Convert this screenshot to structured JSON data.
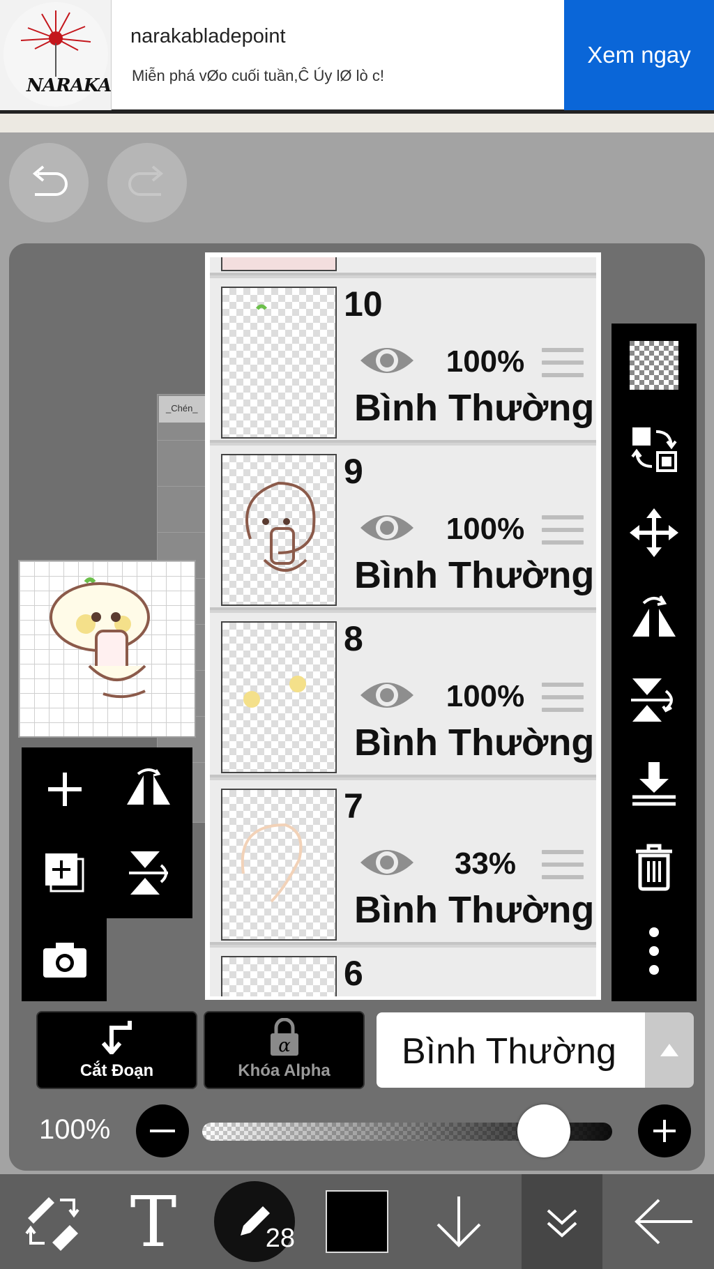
{
  "ad": {
    "title": "narakabladepoint",
    "description": "Miễn phá vØo cuối tuần,Ĉ Úy lØ lò c!",
    "cta": "Xem ngay",
    "logo_text": "NARAKA"
  },
  "canvas": {
    "label": "_Chén_"
  },
  "layers": [
    {
      "number": "10",
      "opacity": "100%",
      "mode": "Bình Thường"
    },
    {
      "number": "9",
      "opacity": "100%",
      "mode": "Bình Thường"
    },
    {
      "number": "8",
      "opacity": "100%",
      "mode": "Bình Thường"
    },
    {
      "number": "7",
      "opacity": "33%",
      "mode": "Bình Thường"
    },
    {
      "number": "6"
    }
  ],
  "controls": {
    "clipping_label": "Cắt Đoạn",
    "alpha_lock_label": "Khóa Alpha",
    "blend_mode": "Bình Thường",
    "opacity_value": "100%",
    "opacity_fraction": 1.0
  },
  "toolbar": {
    "brush_size": "28",
    "color": "#000000"
  },
  "colors": {
    "ad_button": "#0a66d8",
    "panel": "#6f6f6f",
    "background": "#a3a3a3"
  }
}
